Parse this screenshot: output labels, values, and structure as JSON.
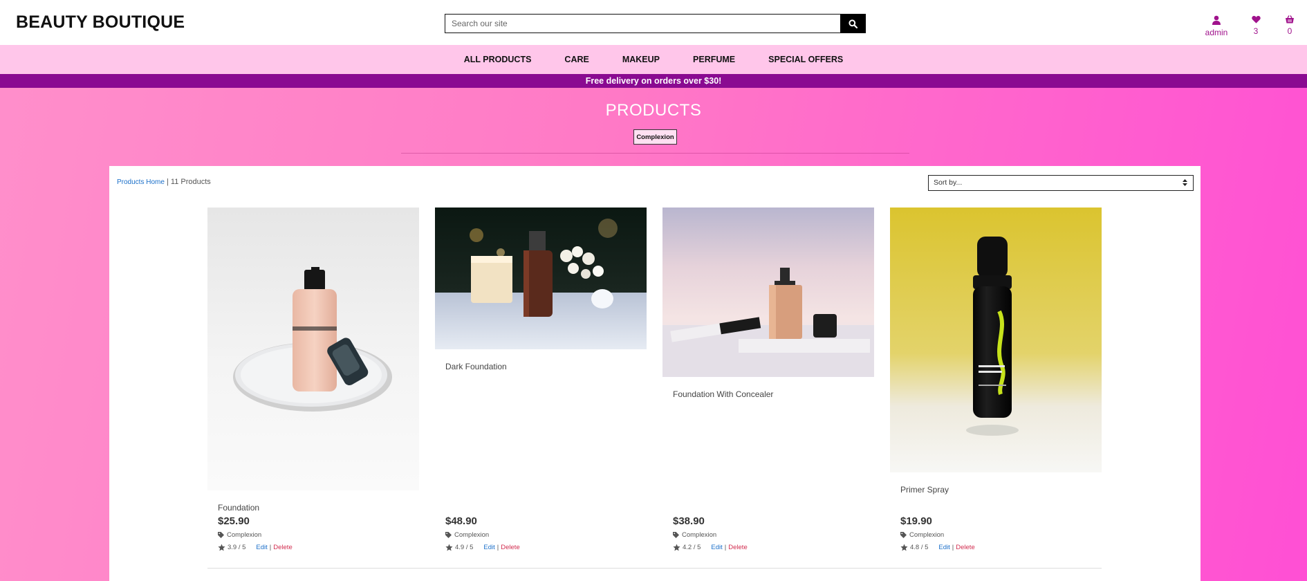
{
  "header": {
    "brand": "BEAUTY BOUTIQUE",
    "search_placeholder": "Search our site",
    "account_label": "admin",
    "wishlist_count": "3",
    "cart_count": "0"
  },
  "nav": {
    "items": [
      "ALL PRODUCTS",
      "CARE",
      "MAKEUP",
      "PERFUME",
      "SPECIAL OFFERS"
    ]
  },
  "promo": "Free delivery on orders over $30!",
  "page": {
    "title": "PRODUCTS",
    "category_badge": "Complexion"
  },
  "listing": {
    "breadcrumb_link": "Products Home",
    "separator": " | ",
    "count": "11 Products",
    "sort_placeholder": "Sort by...",
    "edit_label": "Edit",
    "delete_label": "Delete",
    "separator_edit": "|"
  },
  "products": [
    {
      "name": "Foundation",
      "price": "$25.90",
      "category": "Complexion",
      "rating": "3.9 / 5"
    },
    {
      "name": "Dark Foundation",
      "price": "$48.90",
      "category": "Complexion",
      "rating": "4.9 / 5"
    },
    {
      "name": "Foundation With Concealer",
      "price": "$38.90",
      "category": "Complexion",
      "rating": "4.2 / 5"
    },
    {
      "name": "Primer Spray",
      "price": "$19.90",
      "category": "Complexion",
      "rating": "4.8 / 5"
    }
  ],
  "icons": {
    "search": "search-icon",
    "account": "user-icon",
    "wishlist": "heart-icon",
    "cart": "basket-icon",
    "tag": "tag-icon",
    "rating": "star-icon"
  },
  "colors": {
    "accent": "#a0128c",
    "promo_bar": "#8a0a91",
    "nav_bg": "#ffc6ea",
    "link": "#1a6fc9",
    "delete": "#d22d4f"
  }
}
